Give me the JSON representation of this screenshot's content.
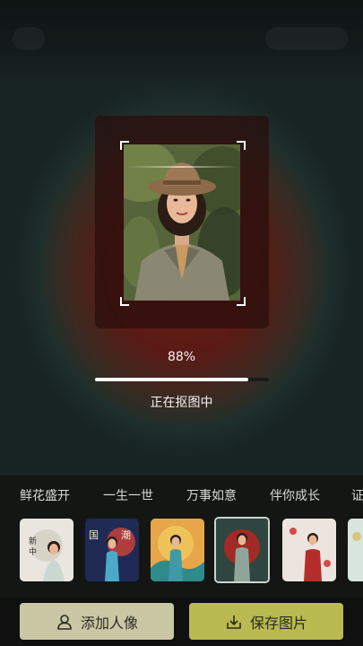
{
  "progress": {
    "percent_label": "88%",
    "value": 0.88
  },
  "status_text": "正在抠图中",
  "tabs": [
    {
      "label": "鲜花盛开"
    },
    {
      "label": "一生一世"
    },
    {
      "label": "万事如意"
    },
    {
      "label": "伴你成长"
    },
    {
      "label": "证"
    }
  ],
  "templates": [
    {
      "name": "template-1",
      "bg": "#e9e6df",
      "accent": "#b5332a"
    },
    {
      "name": "template-2",
      "bg": "#1f2a55",
      "accent": "#c9413a"
    },
    {
      "name": "template-3",
      "bg": "#e7a64a",
      "accent": "#2f8a8c"
    },
    {
      "name": "template-4",
      "bg": "#2e463f",
      "accent": "#a32a24",
      "selected": true
    },
    {
      "name": "template-5",
      "bg": "#ece4de",
      "accent": "#b52d2a"
    },
    {
      "name": "template-6",
      "bg": "#d8e6df",
      "accent": "#d9c47a"
    }
  ],
  "buttons": {
    "add_label": "添加人像",
    "save_label": "保存图片"
  },
  "colors": {
    "add_button": "#c9c7a4",
    "save_button": "#b9ba4f",
    "background_red": "#6b1e16"
  },
  "icons": {
    "add": "person-icon",
    "save": "download-icon"
  }
}
